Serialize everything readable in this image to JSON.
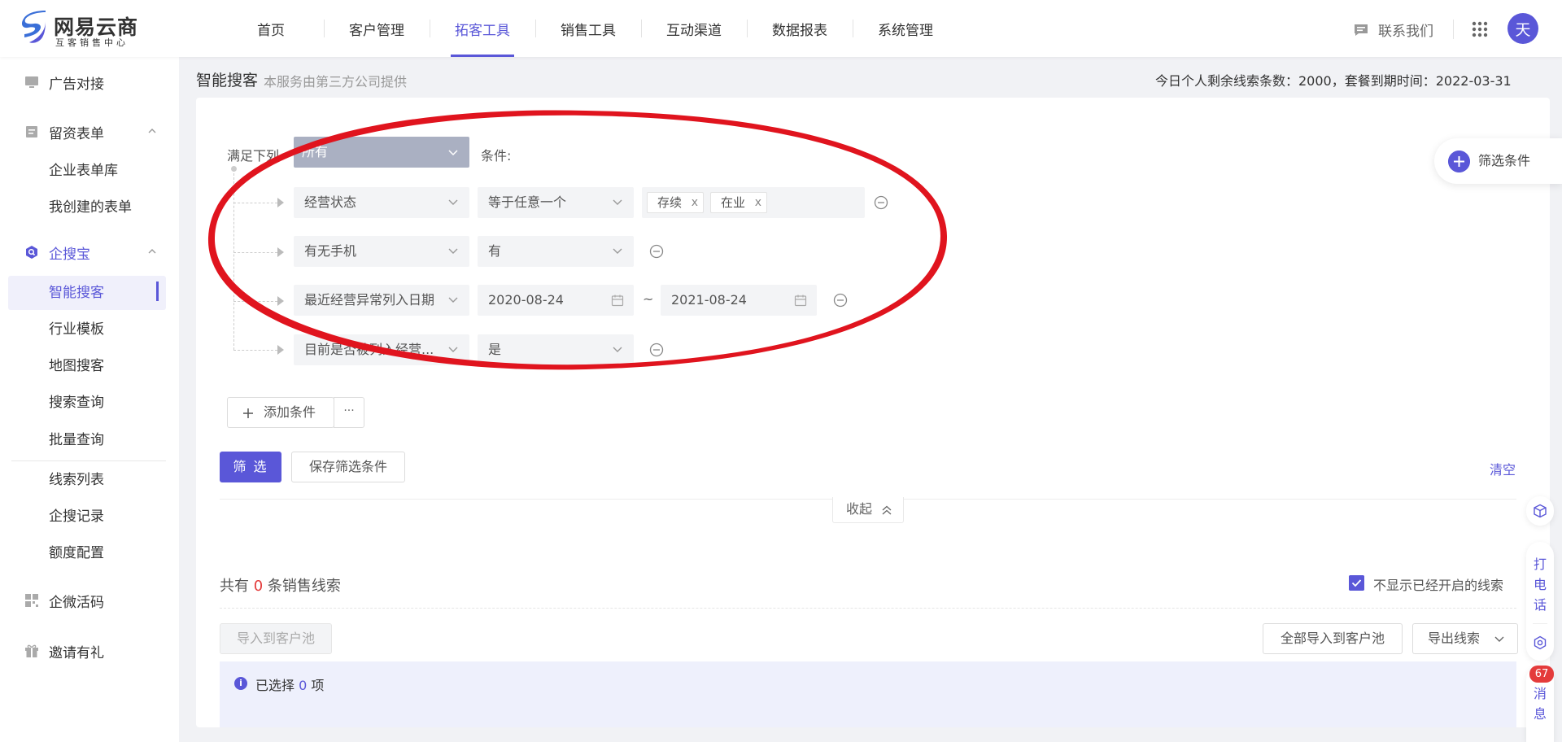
{
  "app": {
    "logo_title": "网易云商",
    "logo_subtitle": "互客销售中心",
    "avatar_initial": "天",
    "contact_label": "联系我们"
  },
  "nav": [
    {
      "label": "首页",
      "active": false
    },
    {
      "label": "客户管理",
      "active": false
    },
    {
      "label": "拓客工具",
      "active": true
    },
    {
      "label": "销售工具",
      "active": false
    },
    {
      "label": "互动渠道",
      "active": false
    },
    {
      "label": "数据报表",
      "active": false
    },
    {
      "label": "系统管理",
      "active": false
    }
  ],
  "sidebar": {
    "groups": [
      {
        "label": "广告对接",
        "icon": "monitor-icon"
      },
      {
        "label": "留资表单",
        "icon": "form-icon",
        "expanded": true
      },
      {
        "label": "企搜宝",
        "icon": "search-shield-icon",
        "expanded": true
      },
      {
        "label": "企微活码",
        "icon": "qrcode-icon"
      },
      {
        "label": "邀请有礼",
        "icon": "gift-icon"
      }
    ],
    "form_items": [
      "企业表单库",
      "我创建的表单"
    ],
    "search_items": [
      "智能搜客",
      "行业模板",
      "地图搜客",
      "搜索查询",
      "批量查询"
    ],
    "lead_items": [
      "线索列表",
      "企搜记录",
      "额度配置"
    ],
    "active_item": "智能搜客"
  },
  "page": {
    "title": "智能搜客",
    "note": "本服务由第三方公司提供",
    "quota_text": "今日个人剩余线索条数：2000，套餐到期时间：2022-03-31"
  },
  "filter": {
    "match_label": "满足下列",
    "match_value": "所有",
    "condition_label": "条件:",
    "rows": [
      {
        "field": "经营状态",
        "operator": "等于任意一个",
        "tags": [
          "存续",
          "在业"
        ]
      },
      {
        "field": "有无手机",
        "operator": "有"
      },
      {
        "field": "最近经营异常列入日期",
        "date_from": "2020-08-24",
        "date_to": "2021-08-24"
      },
      {
        "field": "目前是否被列入经营...",
        "operator": "是"
      }
    ],
    "tilde": "~",
    "tag_close": "x",
    "add_condition": "添加条件",
    "more": "···",
    "filter_button": "筛 选",
    "save_button": "保存筛选条件",
    "clear_link": "清空",
    "collapse": "收起",
    "float_button": "筛选条件"
  },
  "results": {
    "prefix": "共有",
    "count": "0",
    "suffix": "条销售线索",
    "hide_opened_label": "不显示已经开启的线索",
    "hide_opened_checked": true,
    "import_button": "导入到客户池",
    "import_all_button": "全部导入到客户池",
    "export_button": "导出线索",
    "selected_prefix": "已选择",
    "selected_count": "0",
    "selected_suffix": "项"
  },
  "right_tools": {
    "call_label": [
      "打",
      "电",
      "话"
    ],
    "message_label": [
      "消",
      "息"
    ],
    "message_badge": "67"
  },
  "colors": {
    "accent": "#5a57d8",
    "danger": "#e43b3b",
    "annotation": "#e0141e"
  }
}
